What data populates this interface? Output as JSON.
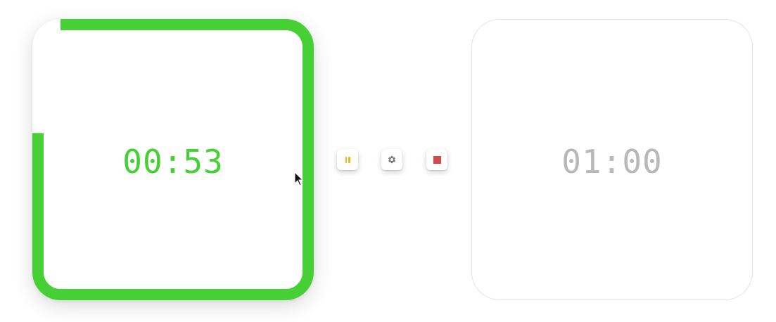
{
  "timers": {
    "active": {
      "time": "00:53",
      "progress": 0.8833,
      "color": "#47cf36"
    },
    "idle": {
      "time": "01:00",
      "color": "#b8b8b8"
    }
  },
  "controls": {
    "pause": {
      "icon": "pause-icon",
      "color": "#f2b01e"
    },
    "settings": {
      "icon": "gear-icon",
      "color": "#7a7a7a"
    },
    "stop": {
      "icon": "stop-icon",
      "color": "#d24b4b"
    }
  }
}
